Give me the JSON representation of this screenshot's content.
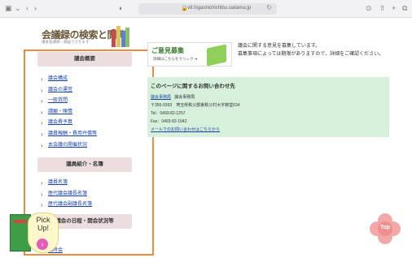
{
  "browser": {
    "url": "v8.higashichichibu.saitama.jp"
  },
  "site": {
    "logo_title": "会議録の検索と閲覧",
    "logo_sub": "議会会議録・録画でさかます"
  },
  "sections": [
    {
      "header": "議会概要",
      "items": [
        "議会構成",
        "議会の運営",
        "一般質問",
        "請願・陳情",
        "議会費予算",
        "議員報酬・費用弁償等",
        "本会議の開催状況"
      ]
    },
    {
      "header": "議員紹介・名簿",
      "items": [
        "議員名簿",
        "歴代議会議長名簿",
        "歴代議会副議長名簿"
      ]
    },
    {
      "header": "議会の日程・開会状況等",
      "items": [
        "日程",
        "臨時会"
      ]
    }
  ],
  "banner": {
    "title": "ご意見募集",
    "sub": "詳細はこちらをクリック ➜"
  },
  "notice": {
    "line1": "議会に関する意見を募集しています。",
    "line2": "募集事項によっては期限がありますので、詳細をご確認ください。"
  },
  "contact": {
    "title": "このページに関するお問い合わせ先",
    "dept_link": "議会事務局",
    "dept": "議会事務局",
    "address": "〒355-0393　埼玉県秩父郡東秩父村大字御堂634",
    "tel": "Tel：0493-82-1257",
    "fax": "Fax：0493-82-1542",
    "mail_link": "メールでのお問い合わせはこちらから"
  },
  "pickup": {
    "label_1": "Pick",
    "label_2": "Up!"
  },
  "top_button": {
    "label": "Top"
  }
}
